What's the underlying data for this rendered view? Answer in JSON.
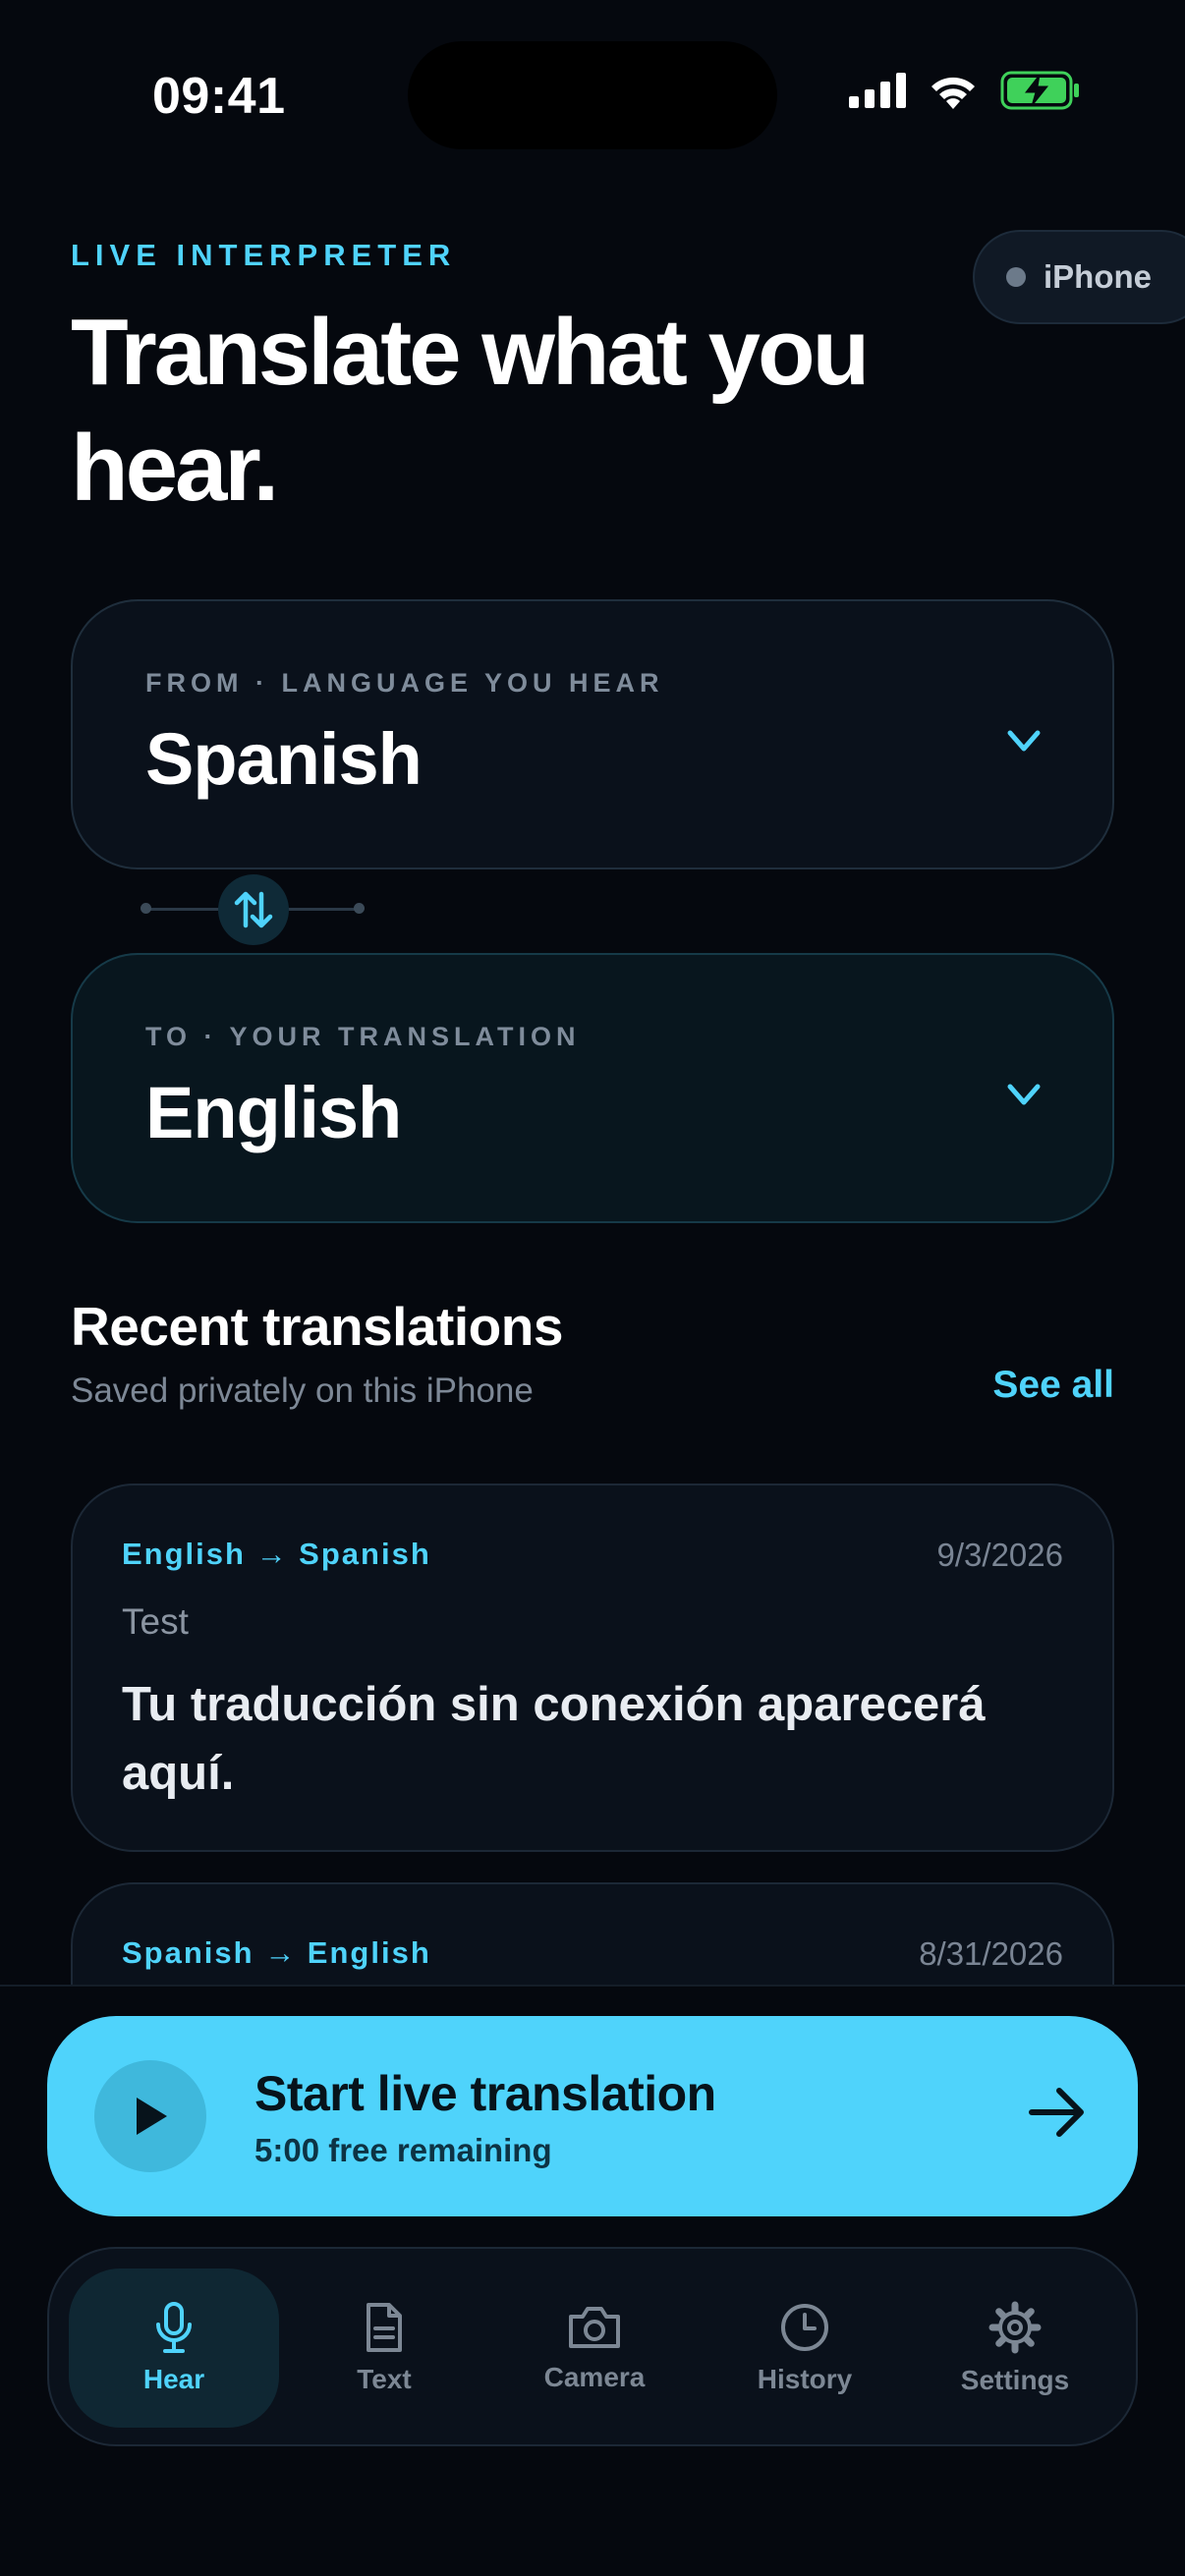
{
  "status_bar": {
    "time": "09:41"
  },
  "header": {
    "eyebrow": "LIVE INTERPRETER",
    "title": "Translate what you hear.",
    "device_pill": "iPhone"
  },
  "from_card": {
    "caption": "FROM · LANGUAGE YOU HEAR",
    "value": "Spanish"
  },
  "to_card": {
    "caption": "TO · YOUR TRANSLATION",
    "value": "English"
  },
  "recent": {
    "title": "Recent translations",
    "subtitle": "Saved privately on this iPhone",
    "see_all": "See all",
    "items": [
      {
        "pair": "English → Spanish",
        "date": "9/3/2026",
        "source": "Test",
        "output": "Tu traducción sin conexión aparecerá aquí."
      },
      {
        "pair": "Spanish → English",
        "date": "8/31/2026"
      }
    ]
  },
  "cta": {
    "title": "Start live translation",
    "subtitle": "5:00 free remaining"
  },
  "tabs": [
    {
      "label": "Hear",
      "icon": "mic-icon",
      "active": true
    },
    {
      "label": "Text",
      "icon": "document-icon",
      "active": false
    },
    {
      "label": "Camera",
      "icon": "camera-icon",
      "active": false
    },
    {
      "label": "History",
      "icon": "clock-icon",
      "active": false
    },
    {
      "label": "Settings",
      "icon": "gear-icon",
      "active": false
    }
  ],
  "colors": {
    "accent": "#4fd3fb",
    "background": "#05080e",
    "card": "#0a111b",
    "battery": "#3fd15a"
  }
}
